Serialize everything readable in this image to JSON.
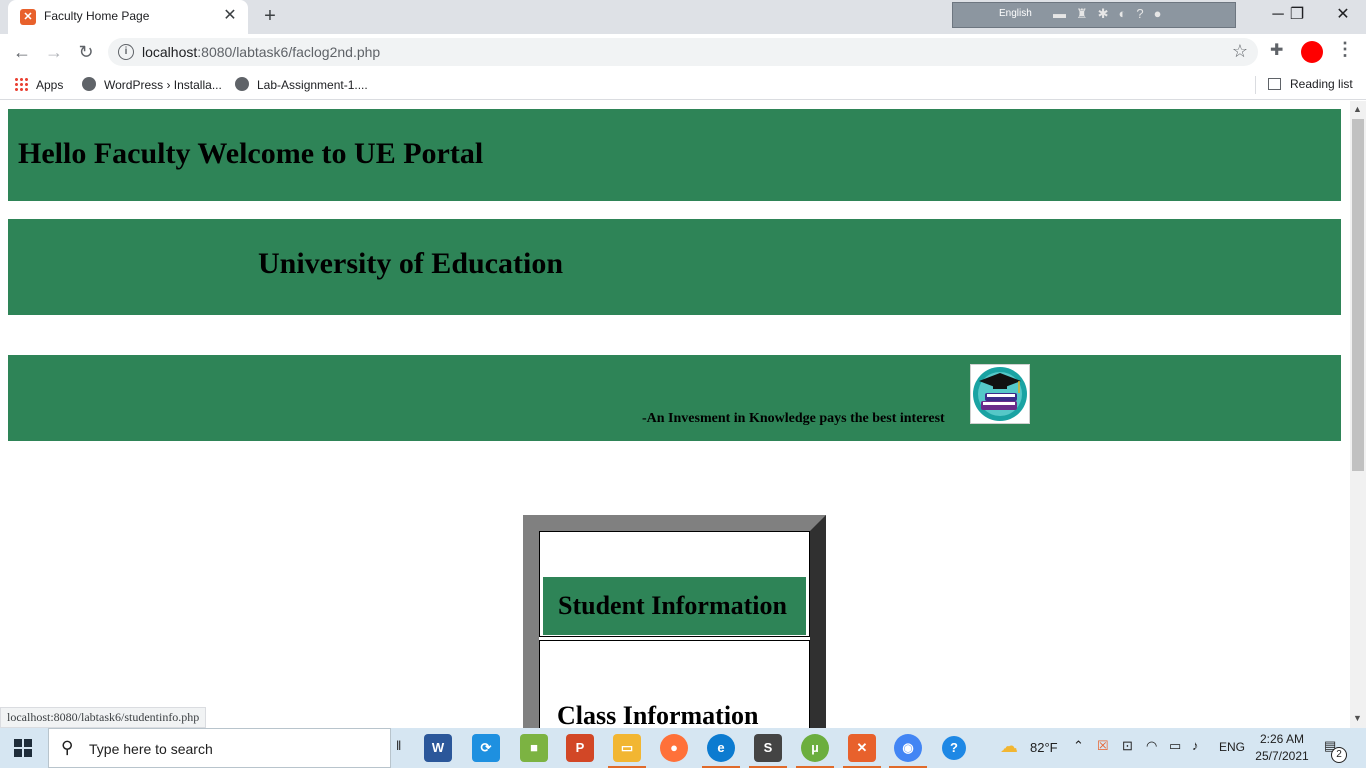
{
  "browser": {
    "tab_title": "Faculty Home Page",
    "tab_close": "✕",
    "new_tab": "+",
    "language_bar": "English",
    "url_host": "localhost",
    "url_path": ":8080/labtask6/faclog2nd.php",
    "bookmarks": {
      "apps": "Apps",
      "item1": "WordPress › Installa...",
      "item2": "Lab-Assignment-1....",
      "reading_list": "Reading list"
    },
    "status_url": "localhost:8080/labtask6/studentinfo.php"
  },
  "page": {
    "header_title": "Hello Faculty Welcome to UE Portal",
    "university_name": "University of Education",
    "motto": "-An Invesment in Knowledge pays the best interest",
    "menu": {
      "student_info": "Student Information",
      "class_info": "Class Information"
    },
    "colors": {
      "banner": "#2e8457"
    }
  },
  "taskbar": {
    "search_placeholder": "Type here to search",
    "temperature": "82°F",
    "language": "ENG",
    "time": "2:26 AM",
    "date": "25/7/2021",
    "notification_count": "2"
  }
}
